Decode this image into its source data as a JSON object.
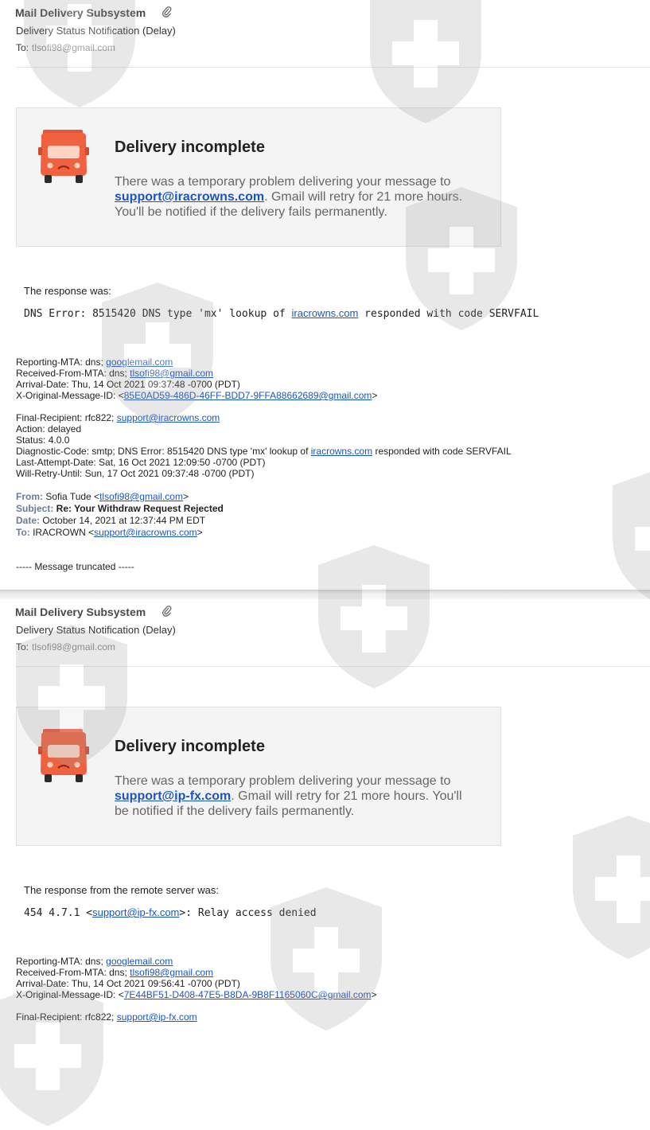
{
  "email1": {
    "sender": "Mail Delivery Subsystem",
    "subject": "Delivery Status Notification (Delay)",
    "to_label": "To:",
    "to_addr": "tlsofi98@gmail.com",
    "card": {
      "title": "Delivery incomplete",
      "body_pre": "There was a temporary problem delivering your message to",
      "link": "support@iracrowns.com",
      "body_post": ". Gmail will retry for 21 more hours. You'll be notified if the delivery fails permanently."
    },
    "response_intro": "The response was:",
    "response_pre": "DNS Error: 8515420 DNS type 'mx' lookup of ",
    "response_link": "iracrowns.com",
    "response_post": " responded with code SERVFAIL",
    "headers": {
      "reporting_mta_label": "Reporting-MTA: dns; ",
      "reporting_mta": "googlemail.com",
      "received_from_label": "Received-From-MTA: dns; ",
      "received_from": "tlsofi98@gmail.com",
      "arrival_date": "Arrival-Date: Thu, 14 Oct 2021 09:37:48 -0700 (PDT)",
      "xorig_label": "X-Original-Message-ID: <",
      "xorig": "85E0AD59-486D-46FF-BDD7-9FFA88662689@gmail.com",
      "xorig_end": ">",
      "final_recipient_label": "Final-Recipient: rfc822; ",
      "final_recipient": "support@iracrowns.com",
      "action": "Action: delayed",
      "status": "Status: 4.0.0",
      "diag_pre": "Diagnostic-Code: smtp; DNS Error: 8515420 DNS type 'mx' lookup of ",
      "diag_link": "iracrowns.com",
      "diag_post": " responded with code SERVFAIL",
      "last_attempt": "Last-Attempt-Date: Sat, 16 Oct 2021 12:09:50 -0700 (PDT)",
      "will_retry": "Will-Retry-Until: Sun, 17 Oct 2021 09:37:48 -0700 (PDT)"
    },
    "original": {
      "from_label": "From:",
      "from_name": " Sofia Tude <",
      "from_addr": "tlsofi98@gmail.com",
      "from_end": ">",
      "subject_label": "Subject:",
      "subject": " Re: Your Withdraw Request Rejected",
      "date_label": "Date:",
      "date": " October 14, 2021 at 12:37:44 PM EDT",
      "to_label": "To:",
      "to_name": " IRACROWN <",
      "to_addr": "support@iracrowns.com",
      "to_end": ">"
    },
    "truncated": "----- Message truncated -----"
  },
  "email2": {
    "sender": "Mail Delivery Subsystem",
    "subject": "Delivery Status Notification (Delay)",
    "to_label": "To:",
    "to_addr": "tlsofi98@gmail.com",
    "card": {
      "title": "Delivery incomplete",
      "body_pre": "There was a temporary problem delivering your message to",
      "link": "support@ip-fx.com",
      "body_post": ". Gmail will retry for 21 more hours. You'll be notified if the delivery fails permanently."
    },
    "response_intro": "The response from the remote server was:",
    "response_pre": "454 4.7.1 <",
    "response_link": "support@ip-fx.com",
    "response_post": ">: Relay access denied",
    "headers": {
      "reporting_mta_label": "Reporting-MTA: dns; ",
      "reporting_mta": "googlemail.com",
      "received_from_label": "Received-From-MTA: dns; ",
      "received_from": "tlsofi98@gmail.com",
      "arrival_date": "Arrival-Date: Thu, 14 Oct 2021 09:56:41 -0700 (PDT)",
      "xorig_label": "X-Original-Message-ID: <",
      "xorig": "7E44BF51-D408-47E5-B8DA-9B8F1165060C@gmail.com",
      "xorig_end": ">",
      "final_recipient_label": "Final-Recipient: rfc822; ",
      "final_recipient": "support@ip-fx.com"
    }
  },
  "colors": {
    "link": "#1a55c4",
    "truck": "#f0623f",
    "card_bg": "#f4f4f4",
    "watermark": "#9a9a9a"
  },
  "icons": [
    "paperclip-icon",
    "sad-truck-icon",
    "shield-cross-watermark"
  ]
}
